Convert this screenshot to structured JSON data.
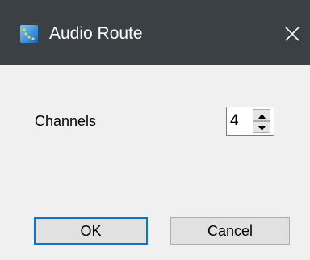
{
  "window": {
    "title": "Audio Route",
    "icon": "audio-route-app-icon",
    "close_icon": "close-icon"
  },
  "form": {
    "channels_label": "Channels",
    "channels_value": "4"
  },
  "buttons": {
    "ok_label": "OK",
    "cancel_label": "Cancel"
  },
  "colors": {
    "titlebar": "#3b4044",
    "dialog_background": "#f0f0f0",
    "default_button_border": "#0078d7"
  }
}
